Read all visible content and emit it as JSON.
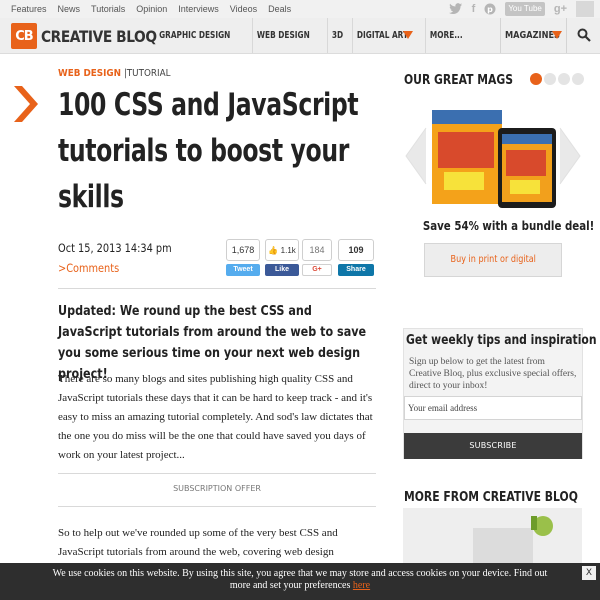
{
  "topbar": {
    "links": [
      "Features",
      "News",
      "Tutorials",
      "Opinion",
      "Interviews",
      "Videos",
      "Deals"
    ],
    "social": {
      "twitter": "twitter-icon",
      "facebook": "f",
      "pinterest": "pinterest-icon",
      "youtube": "You Tube",
      "gplus": "g+"
    }
  },
  "nav": {
    "logo_mark": "CB",
    "logo_text": "CREATIVE BLOQ",
    "items": [
      "GRAPHIC DESIGN",
      "WEB DESIGN",
      "3D",
      "DIGITAL ART",
      "MORE..."
    ],
    "magazines": "MAGAZINES"
  },
  "article": {
    "category": "WEB DESIGN",
    "separator": "|",
    "type": "TUTORIAL",
    "title": "100 CSS and JavaScript tutorials to boost your skills",
    "date": "Oct 15, 2013  14:34 pm",
    "comments_prefix": ">",
    "comments": "Comments",
    "lede": "Updated: We round up the best CSS and JavaScript tutorials from around the web to save you some serious time on your next web design project!",
    "para1": "There are so many blogs and sites publishing high quality CSS and JavaScript tutorials these days that it can be hard to keep track - and it's easy to miss an amazing tutorial completely. And sod's law dictates that the one you do miss will be the one that could have saved you days of work on your latest project...",
    "subscription_offer": "SUBSCRIPTION OFFER",
    "para2": "So to help out we've rounded up some of the very best CSS and JavaScript tutorials from around the web, covering web design"
  },
  "share": {
    "tweet_count": "1,678",
    "tweet_label": "Tweet",
    "like_count": "1.1k",
    "like_label": "Like",
    "gplus_count": "184",
    "gplus_label": "G+",
    "linkedin_count": "109",
    "linkedin_label": "Share"
  },
  "sidebar": {
    "mags_heading": "OUR GREAT MAGS",
    "save_text": "Save 54% with a bundle deal!",
    "buy_label": "Buy in print or digital",
    "tips_heading": "Get weekly tips and inspiration",
    "tips_text": "Sign up below to get the latest from Creative Bloq, plus exclusive special offers, direct to your inbox!",
    "email_placeholder": "Your email address",
    "subscribe_label": "SUBSCRIBE",
    "more_heading": "MORE FROM CREATIVE BLOQ"
  },
  "cookie": {
    "text": "We use cookies on this website. By using this site, you agree that we may store and access cookies on your device. Find out more and set your preferences ",
    "link": "here",
    "close": "X"
  },
  "colors": {
    "accent": "#e8621a",
    "twitter": "#55acee",
    "facebook": "#3b5998",
    "gplus": "#dd4b39",
    "linkedin": "#0e76a8"
  }
}
